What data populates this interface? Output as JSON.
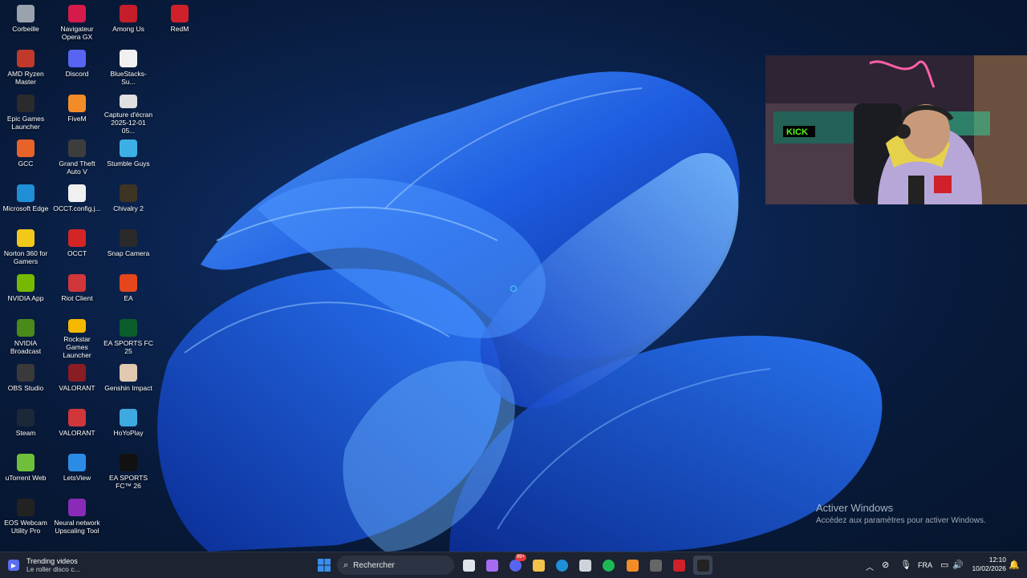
{
  "desktop": {
    "icons": [
      {
        "label": "Corbeille",
        "icon": "recycle-bin-icon",
        "color": "#9aa3ad"
      },
      {
        "label": "AMD Ryzen Master",
        "icon": "amd-ryzen-icon",
        "color": "#c0392b"
      },
      {
        "label": "Epic Games Launcher",
        "icon": "epic-games-icon",
        "color": "#2b2b2b"
      },
      {
        "label": "GCC",
        "icon": "gcc-icon",
        "color": "#e8632a"
      },
      {
        "label": "Microsoft Edge",
        "icon": "edge-icon",
        "color": "#1f8fd6"
      },
      {
        "label": "Norton 360 for Gamers",
        "icon": "norton-icon",
        "color": "#f2c81b"
      },
      {
        "label": "NVIDIA App",
        "icon": "nvidia-icon",
        "color": "#76b900"
      },
      {
        "label": "NVIDIA Broadcast",
        "icon": "nvidia-broadcast-icon",
        "color": "#4a8a1a"
      },
      {
        "label": "OBS Studio",
        "icon": "obs-icon",
        "color": "#3a3a3a"
      },
      {
        "label": "Steam",
        "icon": "steam-icon",
        "color": "#1b2838"
      },
      {
        "label": "uTorrent Web",
        "icon": "utorrent-icon",
        "color": "#6fbf3a"
      },
      {
        "label": "EOS Webcam Utility Pro",
        "icon": "eos-webcam-icon",
        "color": "#222"
      },
      {
        "label": "Navigateur Opera GX",
        "icon": "opera-gx-icon",
        "color": "#d41b4a"
      },
      {
        "label": "Discord",
        "icon": "discord-icon",
        "color": "#5865f2"
      },
      {
        "label": "FiveM",
        "icon": "fivem-icon",
        "color": "#f28c28"
      },
      {
        "label": "Grand Theft Auto V",
        "icon": "gta-icon",
        "color": "#3d3d3d"
      },
      {
        "label": "OCCT.config.j...",
        "icon": "file-icon",
        "color": "#f0f0f0"
      },
      {
        "label": "OCCT",
        "icon": "occt-icon",
        "color": "#d42525"
      },
      {
        "label": "Riot Client",
        "icon": "riot-icon",
        "color": "#d1363a"
      },
      {
        "label": "Rockstar Games Launcher",
        "icon": "rockstar-icon",
        "color": "#f5b800"
      },
      {
        "label": "VALORANT",
        "icon": "valorant-icon",
        "color": "#8a1c24"
      },
      {
        "label": "VALORANT",
        "icon": "riot-icon",
        "color": "#d1363a"
      },
      {
        "label": "LetsView",
        "icon": "letsview-icon",
        "color": "#2b8ce6"
      },
      {
        "label": "Neural network Upscaling Tool",
        "icon": "upscaling-icon",
        "color": "#8a2bb8"
      },
      {
        "label": "Among Us",
        "icon": "among-us-icon",
        "color": "#c41e2a"
      },
      {
        "label": "BlueStacks-Su...",
        "icon": "file-icon",
        "color": "#f0f0f0"
      },
      {
        "label": "Capture d'écran 2025-12-01 05...",
        "icon": "image-file-icon",
        "color": "#e0e0e0"
      },
      {
        "label": "Stumble Guys",
        "icon": "stumble-guys-icon",
        "color": "#3cb0e6"
      },
      {
        "label": "Chivalry 2",
        "icon": "chivalry-icon",
        "color": "#3d3424"
      },
      {
        "label": "Snap Camera",
        "icon": "snap-camera-icon",
        "color": "#2a2a2a"
      },
      {
        "label": "EA",
        "icon": "ea-icon",
        "color": "#e5461c"
      },
      {
        "label": "EA SPORTS FC 25",
        "icon": "ea-fc-icon",
        "color": "#0b5e2b"
      },
      {
        "label": "Genshin Impact",
        "icon": "genshin-icon",
        "color": "#e0c9b0"
      },
      {
        "label": "HoYoPlay",
        "icon": "hoyoplay-icon",
        "color": "#3ea8e0"
      },
      {
        "label": "EA SPORTS FC™ 26",
        "icon": "ea-fc-icon",
        "color": "#111"
      },
      {
        "label": "RedM",
        "icon": "redm-icon",
        "color": "#d0202a"
      }
    ]
  },
  "watermark": {
    "title": "Activer Windows",
    "subtitle": "Accédez aux paramètres pour activer Windows."
  },
  "taskbar": {
    "widget_title": "Trending videos",
    "widget_subtitle": "Le roller disco c...",
    "search_placeholder": "Rechercher",
    "pinned": [
      {
        "name": "start-icon",
        "color": "#3a8ef0"
      },
      {
        "name": "task-view-icon",
        "color": "#dfe3ea"
      },
      {
        "name": "copilot-icon",
        "color": "#a56cf0"
      },
      {
        "name": "discord-icon",
        "color": "#5865f2"
      },
      {
        "name": "file-explorer-icon",
        "color": "#f2c14b"
      },
      {
        "name": "edge-icon",
        "color": "#1f8fd6"
      },
      {
        "name": "store-icon",
        "color": "#d0d4da"
      },
      {
        "name": "spotify-icon",
        "color": "#1db954"
      },
      {
        "name": "fivem-icon",
        "color": "#f28c28"
      },
      {
        "name": "obs-icon",
        "color": "#666"
      },
      {
        "name": "redm-icon",
        "color": "#d0202a"
      },
      {
        "name": "kick-app-icon",
        "color": "#222"
      }
    ],
    "discord_badge": "99+",
    "language": "FRA",
    "time": "12:10",
    "date": "10/02/2026"
  },
  "webcam": {
    "overlay_text": "KICK"
  }
}
